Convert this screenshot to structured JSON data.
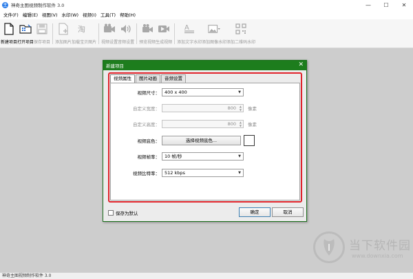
{
  "window": {
    "title": "神奇主图视频制作软件 3.0",
    "app_icon": "主"
  },
  "controls": {
    "minimize": "—",
    "maximize": "☐",
    "close": "✕"
  },
  "menu": [
    "文件(F)",
    "编辑(E)",
    "视图(V)",
    "水印(W)",
    "视频(I)",
    "工具(T)",
    "帮助(H)"
  ],
  "toolbar": [
    {
      "label": "新建项目",
      "icon": "new-file-icon",
      "enabled": true
    },
    {
      "label": "打开项目",
      "icon": "open-folder-icon",
      "enabled": true
    },
    {
      "label": "保存项目",
      "icon": "save-icon",
      "enabled": false
    },
    {
      "label": "添加图片",
      "icon": "add-image-icon",
      "enabled": false
    },
    {
      "label": "加载宝贝图片",
      "icon": "load-product-image-icon",
      "enabled": false
    },
    {
      "label": "视频设置",
      "icon": "video-settings-icon",
      "enabled": false
    },
    {
      "label": "音频设置",
      "icon": "audio-settings-icon",
      "enabled": false
    },
    {
      "label": "预览视频",
      "icon": "preview-video-icon",
      "enabled": false
    },
    {
      "label": "生成视频",
      "icon": "generate-video-icon",
      "enabled": false
    },
    {
      "label": "添加文字水印",
      "icon": "text-watermark-icon",
      "enabled": false
    },
    {
      "label": "添加图像水印",
      "icon": "image-watermark-icon",
      "enabled": false
    },
    {
      "label": "添加二维码水印",
      "icon": "qrcode-watermark-icon",
      "enabled": false
    }
  ],
  "dialog": {
    "title": "新建项目",
    "close": "✕",
    "tabs": [
      "视频属性",
      "图片动画",
      "音频设置"
    ],
    "active_tab": 0,
    "fields": {
      "video_size": {
        "label": "视频尺寸：",
        "value": "400 x 400"
      },
      "custom_width": {
        "label": "自定义宽度：",
        "value": "800",
        "unit": "像素"
      },
      "custom_height": {
        "label": "自定义高度：",
        "value": "800",
        "unit": "像素"
      },
      "video_bg": {
        "label": "视频底色：",
        "button": "选择视频底色...",
        "color": "#ffffff"
      },
      "frame_rate": {
        "label": "视频帧率：",
        "value": "10 帧/秒"
      },
      "bitrate": {
        "label": "视频比特率：",
        "value": "512 kbps"
      }
    },
    "save_default": "保存为默认",
    "ok": "确定",
    "cancel": "取消",
    "highlight_color": "#e0232a",
    "title_color": "#1d7d1d"
  },
  "watermark": {
    "name": "当下软件园",
    "url": "www.downxia.com"
  },
  "status": "神奇主图视频制作软件 3.0"
}
